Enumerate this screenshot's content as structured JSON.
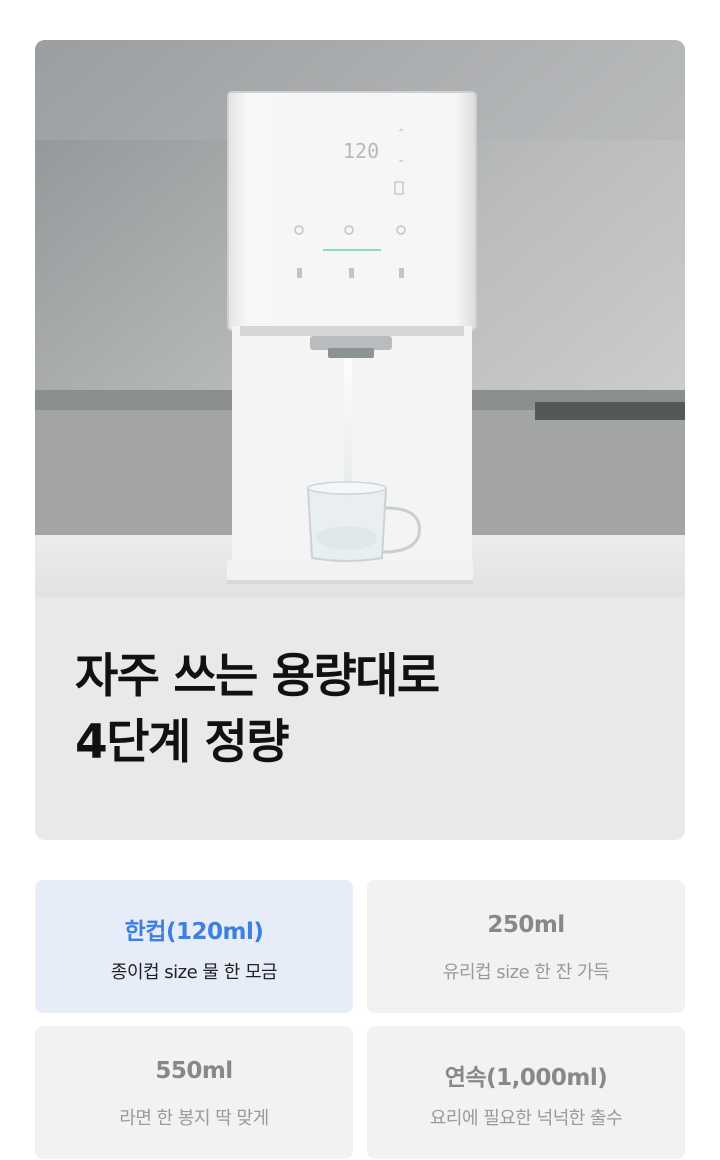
{
  "hero": {
    "headline_line1": "자주 쓰는 용량대로",
    "headline_line2": "4단계 정량",
    "display_readout": "120"
  },
  "options": [
    {
      "title": "한컵(120ml)",
      "description": "종이컵 size 물 한 모금",
      "selected": true
    },
    {
      "title": "250ml",
      "description": "유리컵 size 한 잔 가득",
      "selected": false
    },
    {
      "title": "550ml",
      "description": "라면 한 봉지 딱 맞게",
      "selected": false
    },
    {
      "title": "연속(1,000ml)",
      "description": "요리에 필요한 넉넉한 출수",
      "selected": false
    }
  ],
  "colors": {
    "accent": "#3f7fe0",
    "selected_bg": "#e6ecf8",
    "unselected_bg": "#f2f2f2",
    "card_bg": "#e9e9eb"
  }
}
